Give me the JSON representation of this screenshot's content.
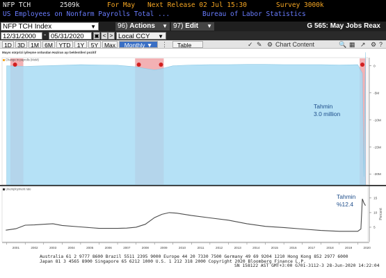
{
  "header": {
    "ticker": "NFP TCH",
    "value": "2509k",
    "for_label": "For May",
    "next_release": "Next Release 02 Jul 15:30",
    "survey": "Survey 3000k",
    "description": "US Employees on Nonfarm Payrolls Total ...",
    "source": "Bureau of Labor Statistics"
  },
  "toolbar": {
    "security": "NFP TCH Index",
    "actions_num": "96)",
    "actions_label": "Actions",
    "edit_num": "97)",
    "edit_label": "Edit",
    "page_title": "G 565: May Jobs Reax"
  },
  "range": {
    "start": "12/31/2000",
    "end": "05/31/2020",
    "currency": "Local CCY"
  },
  "periods": [
    "1D",
    "3D",
    "1M",
    "6M",
    "YTD",
    "1Y",
    "5Y",
    "Max"
  ],
  "frequency": "Monthly",
  "table_label": "Table",
  "chart_content_label": "Chart Content",
  "colors": {
    "area_fill": "#a8dcf4",
    "area_stroke": "#8cc8e4",
    "recession": "#f2a8ac",
    "line": "#4a4a4a",
    "marker_red": "#d22020",
    "bbg_amber": "#f5a623",
    "bbg_blue": "#6a7dff"
  },
  "chart_data": [
    {
      "type": "area",
      "title": "Mayıs sürprizi iyileşme ordusdan Haziran ayı beklentileri pozitif",
      "legend": "Change in payrolls (MoM)",
      "annotation_line1": "Tahmin",
      "annotation_line2": "3.0 million",
      "x_ticks": [
        "2001",
        "2002",
        "2003",
        "2004",
        "2005",
        "2006",
        "2007",
        "2008",
        "2009",
        "2010",
        "2011",
        "2012",
        "2013",
        "2014",
        "2015",
        "2016",
        "2017",
        "2018",
        "2019",
        "2020"
      ],
      "y_ticks": [
        "0",
        "-5M",
        "-10M",
        "-15M",
        "-20M"
      ],
      "ylim": [
        -22,
        1.5
      ],
      "x": [
        2001.0,
        2002.0,
        2003.0,
        2004.0,
        2005.0,
        2006.0,
        2007.0,
        2008.0,
        2008.5,
        2009.0,
        2009.3,
        2010.0,
        2011.0,
        2012.0,
        2013.0,
        2014.0,
        2015.0,
        2016.0,
        2017.0,
        2018.0,
        2019.0,
        2020.0,
        2020.25,
        2020.33,
        2020.42
      ],
      "values": [
        0.0,
        -0.1,
        0.0,
        0.1,
        0.2,
        0.15,
        0.1,
        -0.2,
        -0.5,
        -0.75,
        -0.6,
        0.0,
        0.15,
        0.2,
        0.2,
        0.25,
        0.25,
        0.2,
        0.2,
        0.2,
        0.15,
        0.2,
        -1.4,
        -20.5,
        2.5
      ],
      "recessions": [
        [
          2001.2,
          2001.9
        ],
        [
          2007.95,
          2009.5
        ],
        [
          2020.1,
          2020.45
        ]
      ]
    },
    {
      "type": "line",
      "legend": "Unemployment rate",
      "annotation_line1": "Tahmin",
      "annotation_line2": "%12.4",
      "ylabel": "Percent",
      "y_ticks": [
        "15",
        "10",
        "5"
      ],
      "ylim": [
        0,
        19
      ],
      "x_ticks": [
        "2001",
        "2002",
        "2003",
        "2004",
        "2005",
        "2006",
        "2007",
        "2008",
        "2009",
        "2010",
        "2011",
        "2012",
        "2013",
        "2014",
        "2015",
        "2016",
        "2017",
        "2018",
        "2019",
        "2020"
      ],
      "x": [
        2000.95,
        2001.5,
        2002.0,
        2002.5,
        2003.0,
        2003.5,
        2004.0,
        2005.0,
        2006.0,
        2007.0,
        2007.5,
        2008.0,
        2008.5,
        2009.0,
        2009.4,
        2009.8,
        2010.2,
        2011.0,
        2012.0,
        2013.0,
        2014.0,
        2015.0,
        2016.0,
        2017.0,
        2018.0,
        2019.0,
        2020.0,
        2020.17,
        2020.25,
        2020.33,
        2020.42
      ],
      "values": [
        4.0,
        4.5,
        5.7,
        5.8,
        6.0,
        6.2,
        5.6,
        5.1,
        4.6,
        4.6,
        4.7,
        5.0,
        6.0,
        8.3,
        9.4,
        10.0,
        9.8,
        9.0,
        8.2,
        7.4,
        6.2,
        5.3,
        4.9,
        4.4,
        3.9,
        3.6,
        3.6,
        4.4,
        14.7,
        13.3,
        12.4
      ]
    }
  ],
  "footer": {
    "line1": "Australia 61 2 9777 8600 Brazil 5511 2395 9000 Europe 44 20 7330 7500 Germany 49 69 9204 1210 Hong Kong 852 2977 6000",
    "line2": "Japan 81 3 4565 8900       Singapore 65 6212 1000       U.S. 1 212 318 2000           Copyright 2020 Bloomberg Finance L.P.",
    "line3": "SN 158122 AST  GMT+3:00 G701-3112-3 28-Jun-2020 14:22:04"
  }
}
